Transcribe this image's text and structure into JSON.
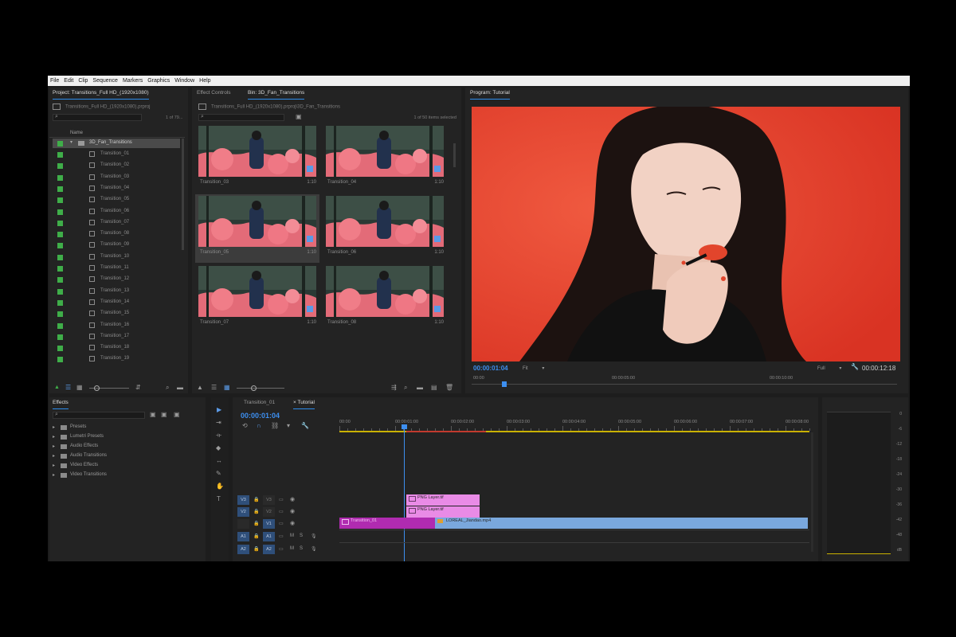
{
  "menu": [
    "File",
    "Edit",
    "Clip",
    "Sequence",
    "Markers",
    "Graphics",
    "Window",
    "Help"
  ],
  "project_panel": {
    "tab": "Project: Transitions_Full HD_(1920x1080)",
    "path": "Transitions_Full HD_(1920x1080).prproj",
    "count": "1 of 79...",
    "column_name": "Name",
    "folder": "3D_Fan_Transitions",
    "items": [
      "Transition_01",
      "Transition_02",
      "Transition_03",
      "Transition_04",
      "Transition_05",
      "Transition_06",
      "Transition_07",
      "Transition_08",
      "Transition_09",
      "Transition_10",
      "Transition_11",
      "Transition_12",
      "Transition_13",
      "Transition_14",
      "Transition_15",
      "Transition_16",
      "Transition_17",
      "Transition_18",
      "Transition_19"
    ]
  },
  "bin_panel": {
    "tab_effect_controls": "Effect Controls",
    "tab_bin": "Bin: 3D_Fan_Transitions",
    "path": "Transitions_Full HD_(1920x1080).prproj\\3D_Fan_Transitions",
    "count": "1 of 50 items selected",
    "thumbs": [
      {
        "name": "Transition_03",
        "dur": "1:10"
      },
      {
        "name": "Transition_04",
        "dur": "1:10"
      },
      {
        "name": "Transition_05",
        "dur": "1:10"
      },
      {
        "name": "Transition_06",
        "dur": "1:10"
      },
      {
        "name": "Transition_07",
        "dur": "1:10"
      },
      {
        "name": "Transition_08",
        "dur": "1:10"
      }
    ]
  },
  "program": {
    "tab": "Program: Tutorial",
    "timecode": "00:00:01:04",
    "fit": "Fit",
    "quality": "Full",
    "duration": "00:00:12:18",
    "ruler": [
      "00:00",
      "00:00:05:00",
      "00:00:10:00"
    ],
    "colors": {
      "background": "#e8402e",
      "timecode": "#3d8ff0"
    }
  },
  "effects_panel": {
    "tab": "Effects",
    "folders": [
      "Presets",
      "Lumetri Presets",
      "Audio Effects",
      "Audio Transitions",
      "Video Effects",
      "Video Transitions"
    ]
  },
  "timeline": {
    "tab1": "Transition_01",
    "tab2": "Tutorial",
    "timecode": "00:00:01:04",
    "ruler": [
      "00:00",
      "00:00:01:00",
      "00:00:02:00",
      "00:00:03:00",
      "00:00:04:00",
      "00:00:05:00",
      "00:00:06:00",
      "00:00:07:00",
      "00:00:08:00"
    ],
    "tracks": [
      "V3",
      "V2",
      "V1",
      "A1",
      "A2"
    ],
    "clips": {
      "v3": "PNG Layer.tif",
      "v2": "PNG Layer.tif",
      "v1_left": "Transition_01",
      "v1_right": "LOREAL_Jiandao.mp4"
    }
  },
  "meters": {
    "labels": [
      "0",
      "-6",
      "-12",
      "-18",
      "-24",
      "-30",
      "-36",
      "-42",
      "-48",
      "dB"
    ]
  }
}
